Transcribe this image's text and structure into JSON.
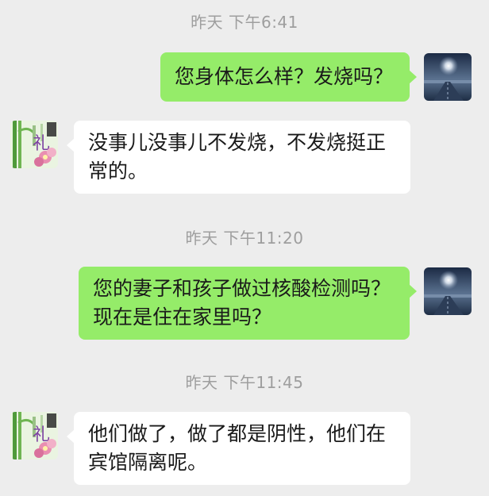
{
  "messages": [
    {
      "time": "昨天 下午6:41"
    },
    {
      "text": "您身体怎么样？发烧吗？"
    },
    {
      "lines": [
        "没事儿没事儿不发烧，不发烧挺正",
        "常的。"
      ]
    },
    {
      "time": "昨天 下午11:20"
    },
    {
      "lines": [
        "您的妻子和孩子做过核酸检测吗？",
        "现在是住在家里吗？"
      ]
    },
    {
      "time": "昨天 下午11:45"
    },
    {
      "lines": [
        "他们做了，做了都是阴性，他们在",
        "宾馆隔离呢。"
      ]
    }
  ],
  "avatars": {
    "self": {
      "icon": "night-moon-road-avatar-icon",
      "colors": [
        "#1d3557",
        "#8ea3bf"
      ]
    },
    "contact": {
      "icon": "bamboo-flower-gift-avatar-icon",
      "glyph": "礼",
      "colors": [
        "#4f9a3a",
        "#e98fb1"
      ]
    }
  }
}
